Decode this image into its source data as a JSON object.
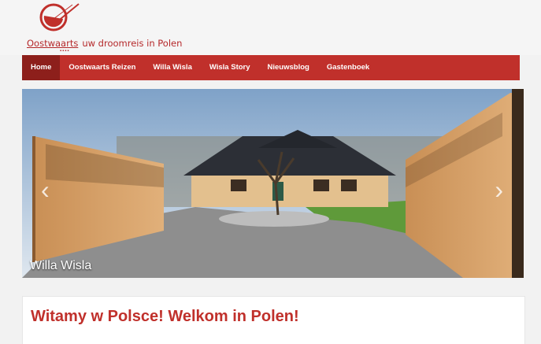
{
  "logo": {
    "brand": "Oostwaarts",
    "tagline": "uw droomreis in Polen",
    "dots": "▪▪▪▪"
  },
  "nav": {
    "items": [
      {
        "label": "Home",
        "active": true
      },
      {
        "label": "Oostwaarts Reizen",
        "active": false
      },
      {
        "label": "Willa Wisla",
        "active": false
      },
      {
        "label": "Wisla Story",
        "active": false
      },
      {
        "label": "Nieuwsblog",
        "active": false
      },
      {
        "label": "Gastenboek",
        "active": false
      }
    ]
  },
  "slider": {
    "caption": "Willa Wisla",
    "prev_icon": "chevron-left-icon",
    "next_icon": "chevron-right-icon"
  },
  "content": {
    "heading": "Witamy w Polsce! Welkom in Polen!"
  },
  "colors": {
    "brand_red": "#c0302b",
    "nav_active": "#8d1f1b",
    "background": "#f2f2f2"
  }
}
